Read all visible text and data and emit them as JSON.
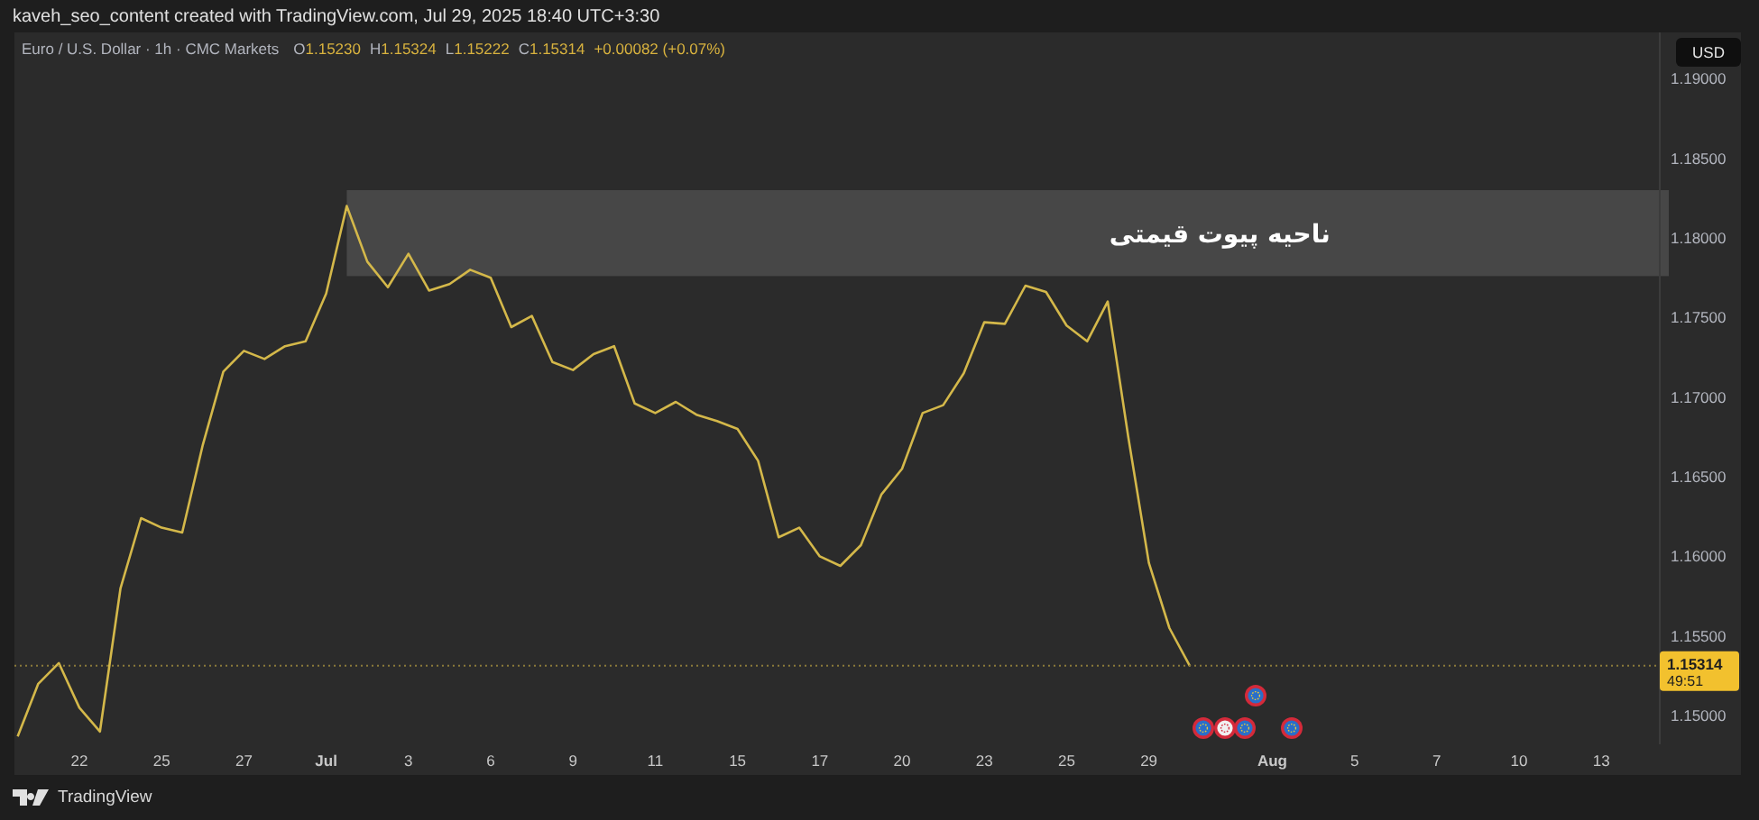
{
  "attribution": "kaveh_seo_content created with TradingView.com, Jul 29, 2025 18:40 UTC+3:30",
  "legend": {
    "symbol": "Euro / U.S. Dollar · 1h · CMC Markets",
    "ohlc": [
      {
        "label": "O",
        "value": "1.15230"
      },
      {
        "label": "H",
        "value": "1.15324"
      },
      {
        "label": "L",
        "value": "1.15222"
      },
      {
        "label": "C",
        "value": "1.15314"
      }
    ],
    "change": "+0.00082 (+0.07%)"
  },
  "currency_button": "USD",
  "chart": {
    "chart_data": {
      "type": "line",
      "ylim": [
        1.1482,
        1.1929
      ],
      "categories": [
        null,
        null,
        null,
        "22",
        null,
        null,
        null,
        "25",
        null,
        null,
        null,
        "27",
        null,
        null,
        null,
        "Jul",
        null,
        null,
        null,
        "3",
        null,
        null,
        null,
        "6",
        null,
        null,
        null,
        "9",
        null,
        null,
        null,
        "11",
        null,
        null,
        null,
        "15",
        null,
        null,
        null,
        "17",
        null,
        null,
        null,
        "20",
        null,
        null,
        null,
        "23",
        null,
        null,
        null,
        "25",
        null,
        null,
        null,
        "29",
        null,
        null,
        null,
        null,
        null,
        "Aug",
        null,
        null,
        null,
        "5",
        null,
        null,
        null,
        "7",
        null,
        null,
        null,
        "10",
        null,
        null,
        null,
        "13"
      ],
      "series": [
        {
          "color": "#d4b84a",
          "values": [
            1.1487,
            1.152,
            1.1533,
            1.1505,
            1.149,
            1.158,
            1.1624,
            1.1618,
            1.1615,
            1.167,
            1.1716,
            1.1729,
            1.1724,
            1.1732,
            1.1735,
            1.1765,
            1.182,
            1.1785,
            1.1769,
            1.179,
            1.1767,
            1.1771,
            1.178,
            1.1775,
            1.1744,
            1.1751,
            1.1722,
            1.1717,
            1.1727,
            1.1732,
            1.1696,
            1.169,
            1.1697,
            1.1689,
            1.1685,
            1.168,
            1.166,
            1.1612,
            1.1618,
            1.16,
            1.1594,
            1.1607,
            1.1639,
            1.1655,
            1.169,
            1.1695,
            1.1715,
            1.1747,
            1.1746,
            1.177,
            1.1766,
            1.1745,
            1.1735,
            1.176,
            1.1675,
            1.1596,
            1.1555,
            1.1531,
            null,
            null,
            null,
            null,
            null,
            null,
            null,
            null,
            null,
            null,
            null,
            null,
            null,
            null,
            null,
            null,
            null,
            null,
            null,
            null
          ]
        }
      ],
      "yticks": [
        {
          "value": 1.15,
          "label": "1.15000"
        },
        {
          "value": 1.155,
          "label": "1.15500"
        },
        {
          "value": 1.16,
          "label": "1.16000"
        },
        {
          "value": 1.165,
          "label": "1.16500"
        },
        {
          "value": 1.17,
          "label": "1.17000"
        },
        {
          "value": 1.175,
          "label": "1.17500"
        },
        {
          "value": 1.18,
          "label": "1.18000"
        },
        {
          "value": 1.185,
          "label": "1.18500"
        },
        {
          "value": 1.19,
          "label": "1.19000"
        }
      ],
      "bands": [
        {
          "axis": "y",
          "from": 1.1776,
          "to": 1.183,
          "label": "ناحیه پیوت قیمتی"
        }
      ],
      "ref_lines": [
        {
          "axis": "y",
          "color": "#8a7a3a",
          "value": 1.15314,
          "label": "1.15314"
        }
      ]
    },
    "countdown": "49:51"
  },
  "footer": {
    "brand": "TradingView"
  }
}
